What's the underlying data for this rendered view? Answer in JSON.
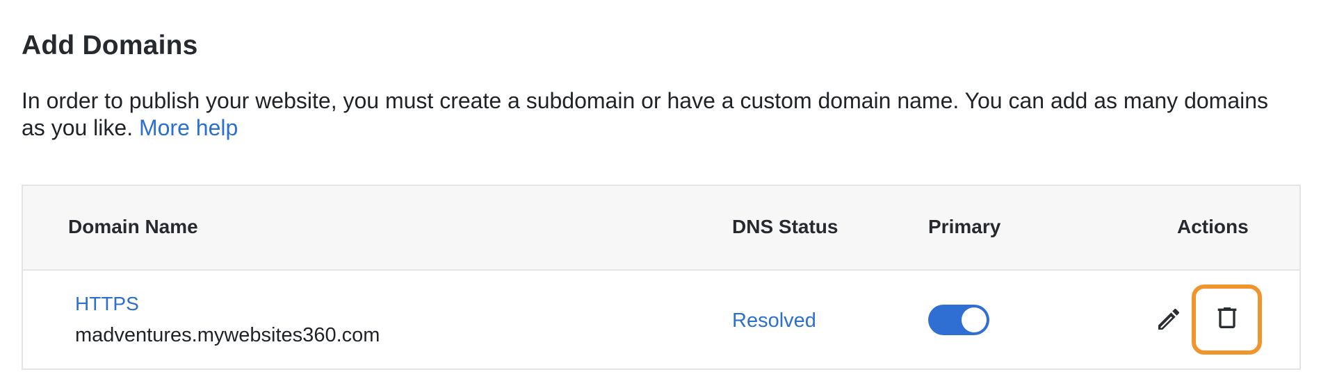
{
  "header": {
    "title": "Add Domains",
    "description": "In order to publish your website, you must create a subdomain or have a custom domain name. You can add as many domains as you like.",
    "help_link": "More help"
  },
  "table": {
    "columns": {
      "domain_name": "Domain Name",
      "dns_status": "DNS Status",
      "primary": "Primary",
      "actions": "Actions"
    },
    "rows": [
      {
        "protocol": "HTTPS",
        "domain": "madventures.mywebsites360.com",
        "dns_status": "Resolved",
        "primary": true
      }
    ]
  },
  "icons": {
    "edit": "pencil-icon",
    "delete": "trash-icon"
  },
  "colors": {
    "link": "#2b6fd0",
    "toggle_on": "#2f6fd3",
    "highlight": "#f0952e",
    "header_bg": "#f7f7f7"
  }
}
